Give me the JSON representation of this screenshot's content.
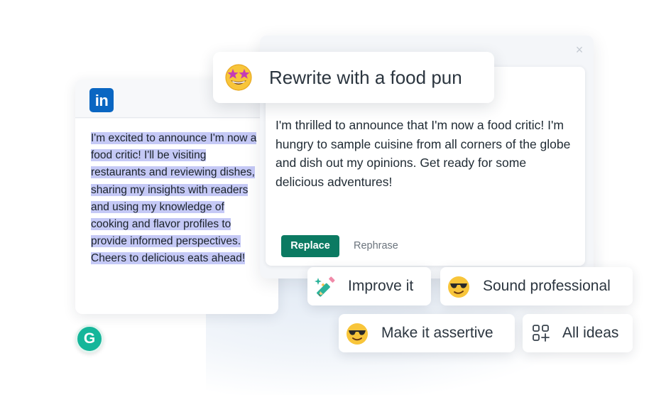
{
  "linkedin": {
    "logo_text": "in",
    "post_text": "I'm excited to announce I'm now a food critic! I'll be visiting restaurants and reviewing dishes, sharing my insights with readers and using my knowledge of cooking and flavor profiles to provide informed perspectives. Cheers to delicious eats ahead!"
  },
  "grammarly": {
    "badge": "G"
  },
  "prompt": {
    "label": "Rewrite with a food pun",
    "emoji": "star-struck-emoji"
  },
  "suggestion": {
    "text": "I'm thrilled to announce that I'm now a food critic! I'm hungry to sample cuisine from all corners of the globe and dish out my opinions. Get ready for some delicious adventures!",
    "close": "×",
    "replace_label": "Replace",
    "rephrase_label": "Rephrase"
  },
  "chips": {
    "improve": "Improve it",
    "professional": "Sound professional",
    "assertive": "Make it assertive",
    "ideas": "All ideas"
  },
  "colors": {
    "accent": "#0b7a62",
    "linkedin": "#0a66c2",
    "grammarly": "#15b69a",
    "highlight": "#c5c9f6"
  }
}
